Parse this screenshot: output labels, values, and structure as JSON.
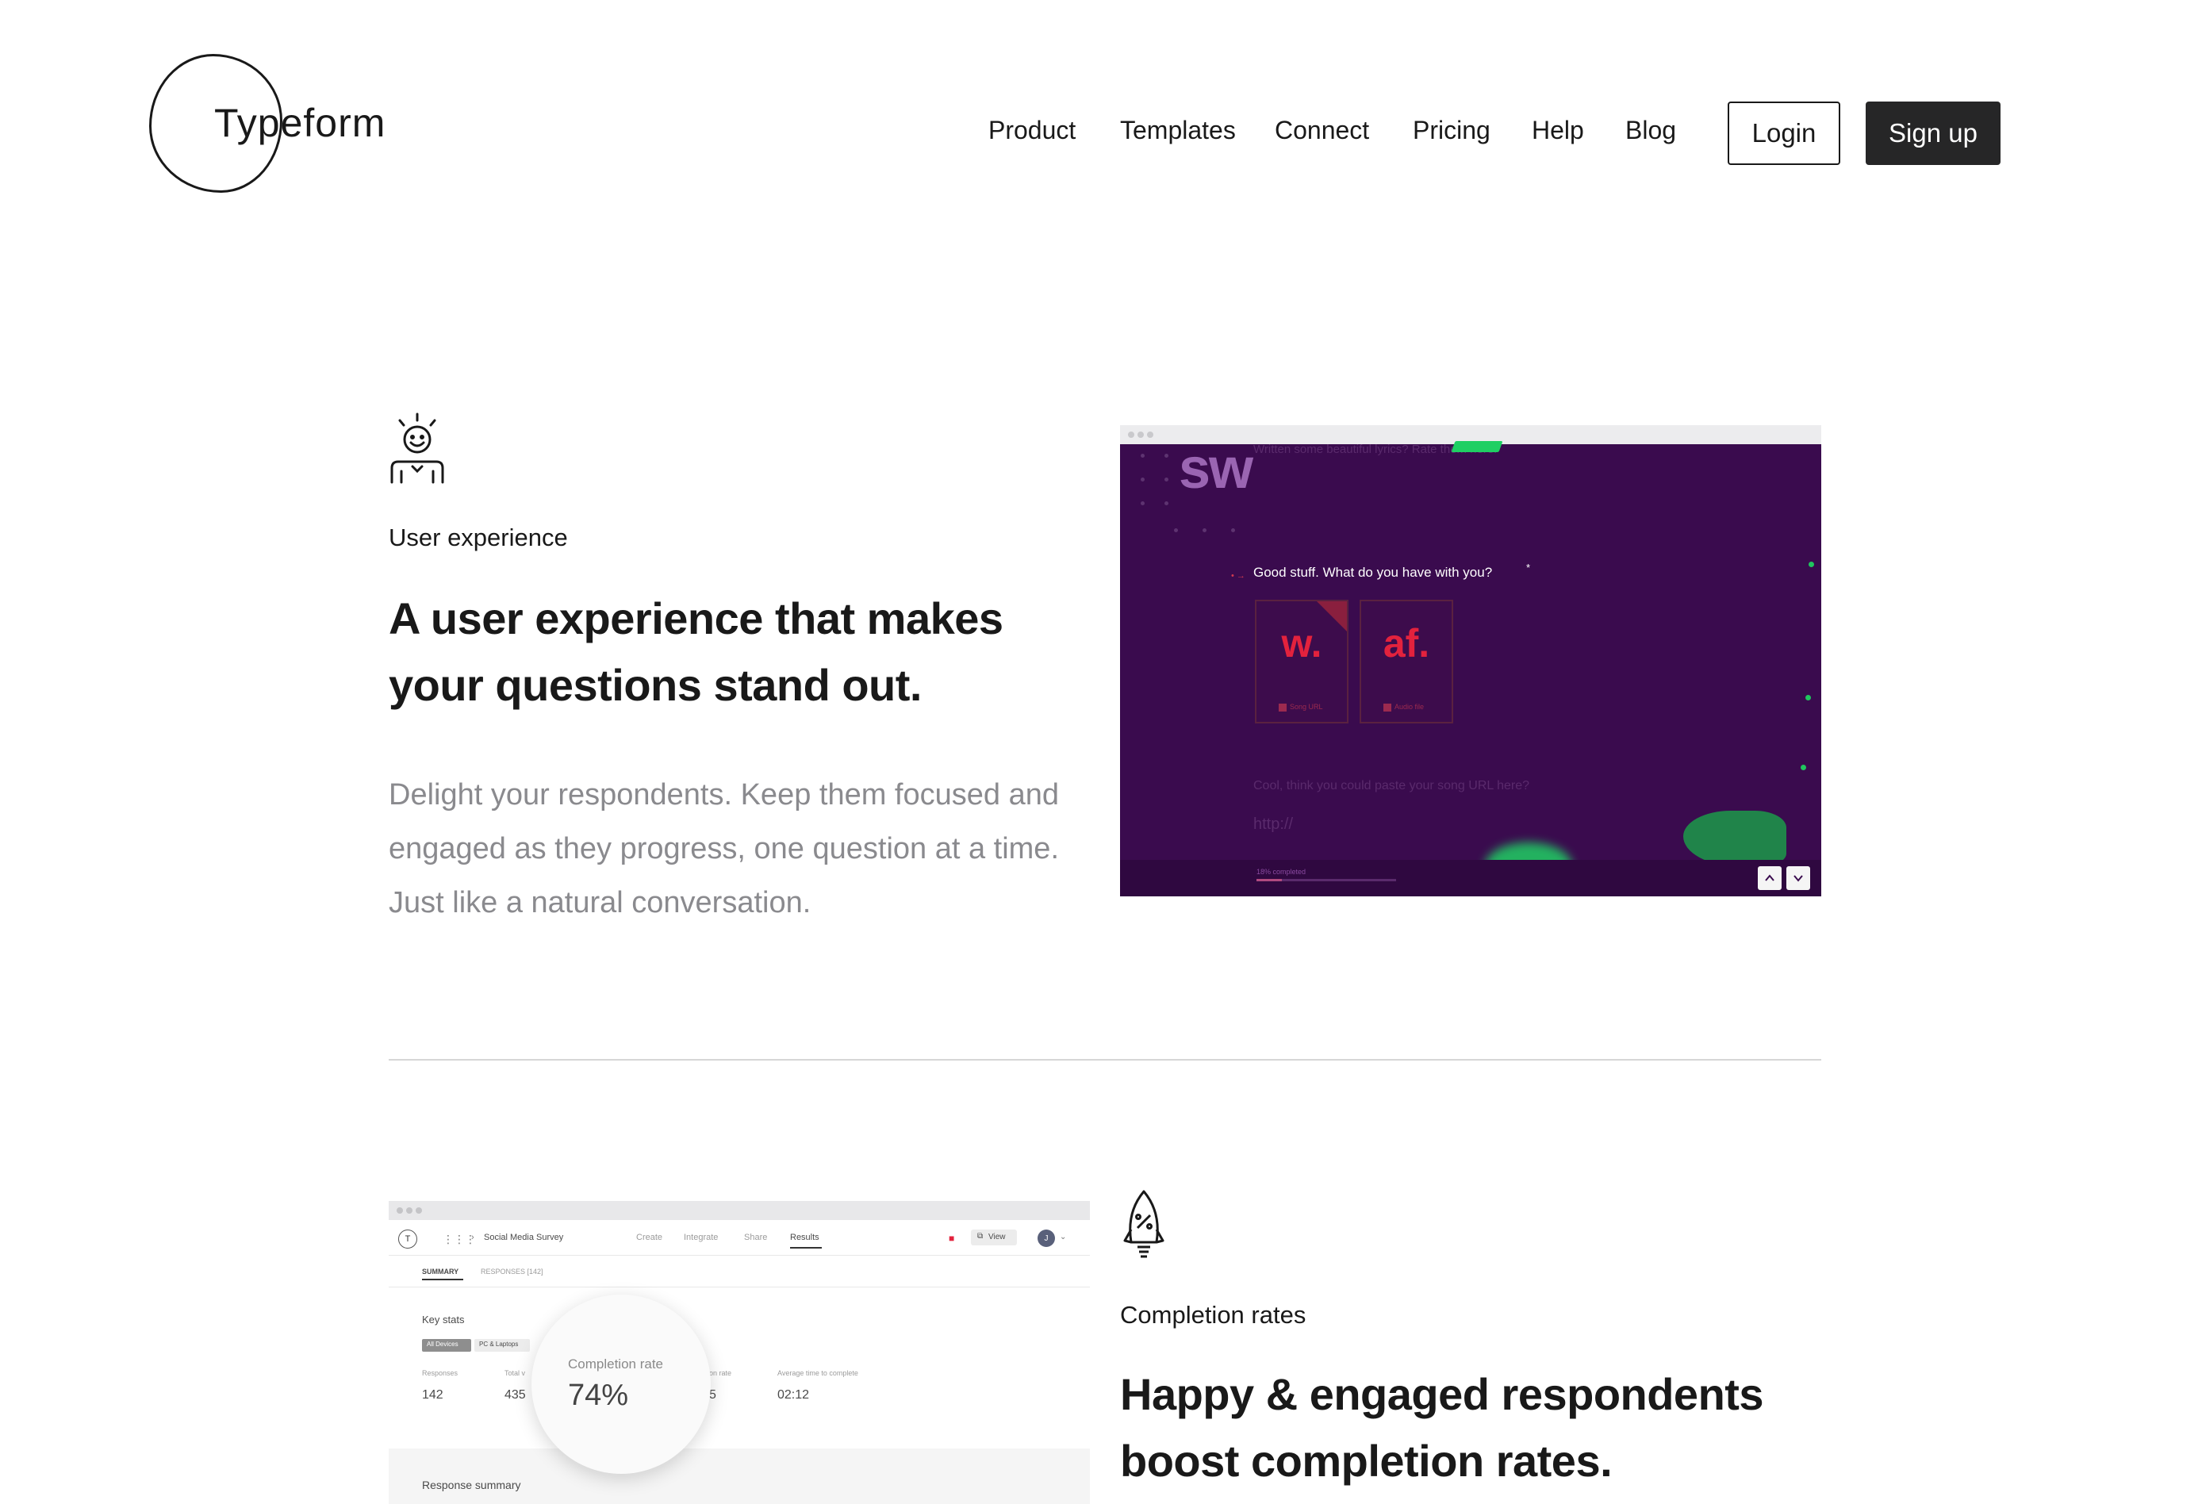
{
  "header": {
    "logo_text": "Typeform",
    "nav": [
      "Product",
      "Templates",
      "Connect",
      "Pricing",
      "Help",
      "Blog"
    ],
    "login_label": "Login",
    "signup_label": "Sign up"
  },
  "section1": {
    "icon": "smiling-user-icon",
    "eyebrow": "User experience",
    "headline_lines": [
      "A user experience that makes",
      "your questions stand out."
    ],
    "body_lines": [
      "Delight your respondents. Keep them focused and",
      "engaged as they progress, one question at a time.",
      "Just like a natural conversation."
    ],
    "screenshot": {
      "brand_mark": "sw",
      "top_faded_text": "Written some beautiful lyrics? Rate them here.",
      "question": "Good stuff. What do you have with you?",
      "required_mark": "*",
      "choices": [
        {
          "letter": "w.",
          "key": "A",
          "label": "Song URL"
        },
        {
          "letter": "af.",
          "key": "B",
          "label": "Audio file"
        }
      ],
      "next_question": "Cool, think you could paste your song URL here?",
      "input_placeholder": "http://",
      "progress_text": "18% completed",
      "progress": 0.18,
      "colors": {
        "background": "#3a0b4e",
        "accent": "#e3223d",
        "green": "#1fcf63"
      }
    }
  },
  "section2": {
    "icon": "rocket-percent-icon",
    "eyebrow": "Completion rates",
    "headline_lines": [
      "Happy & engaged respondents",
      "boost completion rates."
    ],
    "screenshot": {
      "logo_letter": "T",
      "form_title": "Social Media Survey",
      "tabs": [
        "Create",
        "Integrate",
        "Share",
        "Results"
      ],
      "view_label": "View",
      "avatar_initial": "J",
      "subtabs": [
        "SUMMARY",
        "RESPONSES [142]"
      ],
      "key_stats_title": "Key stats",
      "device_filters": [
        "All Devices",
        "PC & Laptops"
      ],
      "stats": [
        {
          "label": "Responses",
          "value": "142"
        },
        {
          "label": "Total v",
          "value": "435"
        },
        {
          "label": "on rate",
          "value": "5"
        },
        {
          "label": "Average time to complete",
          "value": "02:12"
        }
      ],
      "completion_label": "Completion rate",
      "completion_value": "74%",
      "response_summary": "Response summary"
    }
  }
}
